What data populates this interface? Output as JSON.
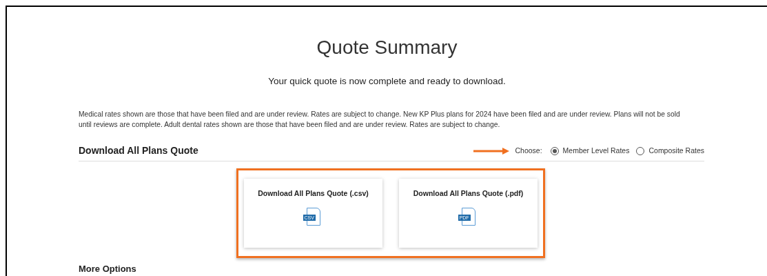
{
  "title": "Quote Summary",
  "subtitle": "Your quick quote is now complete and ready to download.",
  "disclaimer": "Medical rates shown are those that have been filed and are under review. Rates are subject to change. New KP Plus plans for 2024 have been filed and are under review. Plans will not be sold until reviews are complete. Adult dental rates shown are those that have been filed and are under review. Rates are subject to change.",
  "section": {
    "heading": "Download All Plans Quote",
    "choose_label": "Choose:",
    "options": [
      {
        "label": "Member Level Rates",
        "selected": true
      },
      {
        "label": "Composite Rates",
        "selected": false
      }
    ]
  },
  "downloads": [
    {
      "title": "Download All Plans Quote (.csv)",
      "file_tag": "CSV"
    },
    {
      "title": "Download All Plans Quote (.pdf)",
      "file_tag": "PDF"
    }
  ],
  "more_heading": "More Options"
}
